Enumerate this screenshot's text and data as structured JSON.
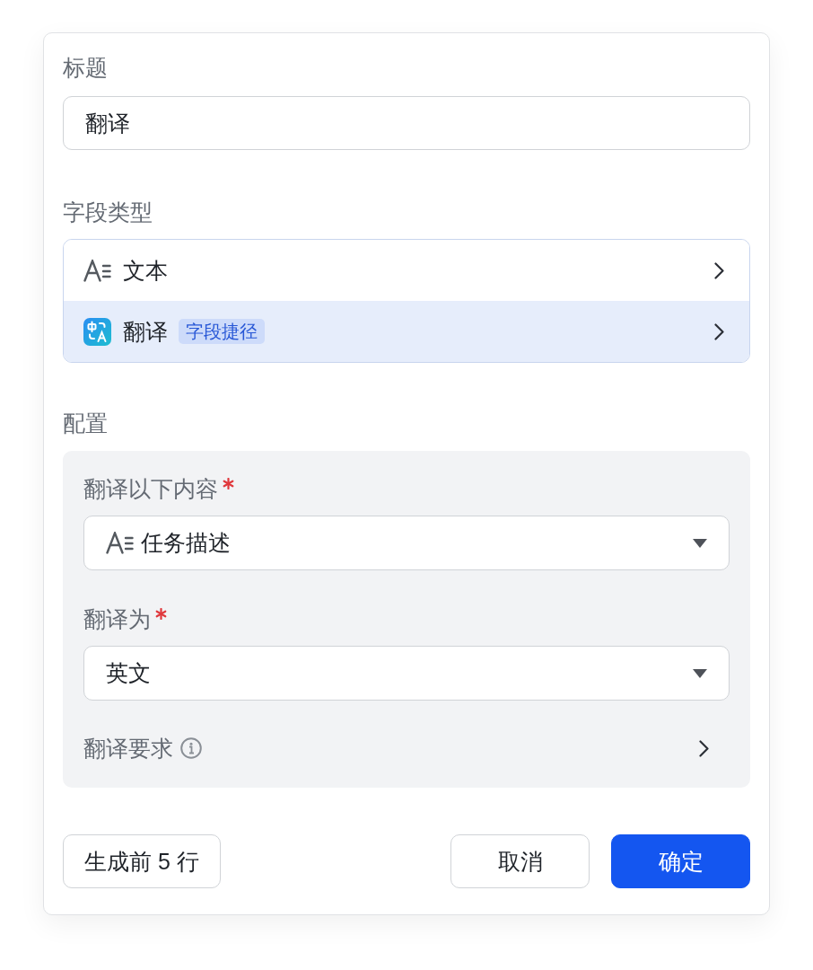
{
  "title_field": {
    "label": "标题",
    "value": "翻译"
  },
  "field_type": {
    "label": "字段类型",
    "options": [
      {
        "kind": "text",
        "label": "文本",
        "selected": false
      },
      {
        "kind": "shortcut",
        "label": "翻译",
        "badge": "字段捷径",
        "selected": true
      }
    ]
  },
  "config": {
    "label": "配置",
    "fields": [
      {
        "kind": "field-select",
        "label": "翻译以下内容",
        "required": true,
        "value": "任务描述"
      },
      {
        "kind": "select",
        "label": "翻译为",
        "required": true,
        "value": "英文"
      },
      {
        "kind": "link",
        "label": "翻译要求",
        "info": true
      }
    ]
  },
  "footer": {
    "left_buttons": [
      {
        "kind": "secondary",
        "label": "生成前 5 行"
      }
    ],
    "right_buttons": [
      {
        "kind": "secondary",
        "label": "取消"
      },
      {
        "kind": "primary",
        "label": "确定"
      }
    ]
  }
}
